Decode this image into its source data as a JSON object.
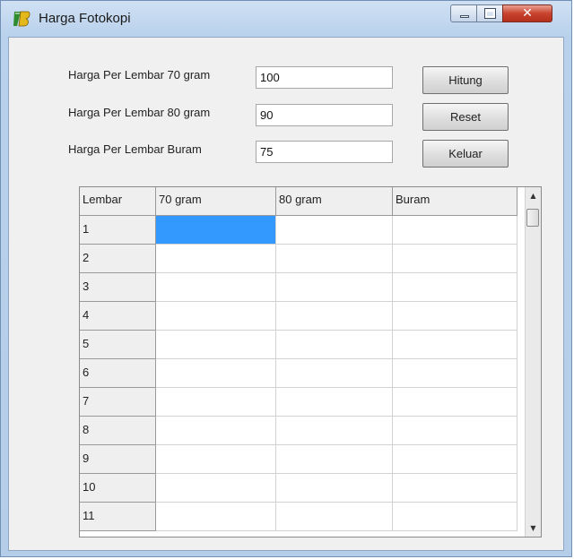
{
  "window": {
    "title": "Harga Fotokopi",
    "icon": "app-logo-icon",
    "controls": {
      "minimize_icon": "minimize-icon",
      "maximize_icon": "maximize-icon",
      "close_icon": "close-icon",
      "close_glyph": "✕"
    }
  },
  "form": {
    "label_70": "Harga Per Lembar 70 gram",
    "label_80": "Harga Per Lembar 80 gram",
    "label_buram": "Harga Per Lembar Buram",
    "value_70": "100",
    "value_80": "90",
    "value_buram": "75"
  },
  "buttons": {
    "hitung": "Hitung",
    "reset": "Reset",
    "keluar": "Keluar"
  },
  "grid": {
    "columns": [
      "Lembar",
      "70 gram",
      "80 gram",
      "Buram"
    ],
    "rows": [
      "1",
      "2",
      "3",
      "4",
      "5",
      "6",
      "7",
      "8",
      "9",
      "10",
      "11"
    ],
    "selected_cell": {
      "row": 1,
      "column": "70 gram"
    }
  },
  "scrollbar": {
    "up_glyph": "▲",
    "down_glyph": "▼"
  },
  "colors": {
    "selection": "#3399ff",
    "titlebar": "#b9d1ec",
    "close_button": "#c9432f"
  }
}
